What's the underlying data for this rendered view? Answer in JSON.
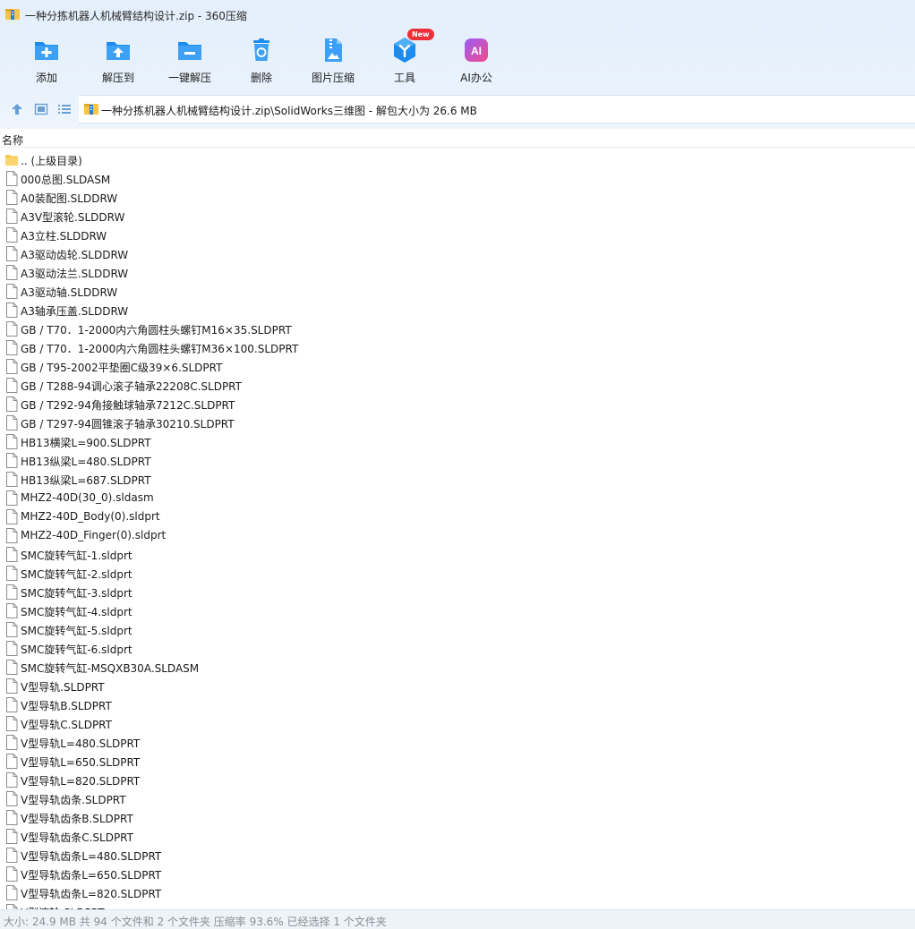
{
  "window": {
    "title": "一种分拣机器人机械臂结构设计.zip - 360压缩"
  },
  "toolbar": {
    "add": "添加",
    "extract_to": "解压到",
    "one_click_extract": "一键解压",
    "delete": "删除",
    "image_compress": "图片压缩",
    "tools": "工具",
    "tools_badge": "New",
    "ai_office": "AI办公",
    "ai_icon_text": "AI"
  },
  "colors": {
    "accent": "#1c8cf0",
    "badge": "#ef2f37",
    "folder": "#f6c54a",
    "ai_gradient_start": "#9b5cf6",
    "ai_gradient_end": "#f24b8a"
  },
  "address": {
    "path": "一种分拣机器人机械臂结构设计.zip\\SolidWorks三维图 - 解包大小为 26.6 MB"
  },
  "list": {
    "column_name": "名称",
    "files": [
      {
        "name": ".. (上级目录)",
        "icon": "folder-icon"
      },
      {
        "name": "000总图.SLDASM",
        "icon": "file-icon"
      },
      {
        "name": "A0装配图.SLDDRW",
        "icon": "file-icon"
      },
      {
        "name": "A3V型滚轮.SLDDRW",
        "icon": "file-icon"
      },
      {
        "name": "A3立柱.SLDDRW",
        "icon": "file-icon"
      },
      {
        "name": "A3驱动齿轮.SLDDRW",
        "icon": "file-icon"
      },
      {
        "name": "A3驱动法兰.SLDDRW",
        "icon": "file-icon"
      },
      {
        "name": "A3驱动轴.SLDDRW",
        "icon": "file-icon"
      },
      {
        "name": "A3轴承压盖.SLDDRW",
        "icon": "file-icon"
      },
      {
        "name": "GB / T70．1-2000内六角圆柱头螺钉M16×35.SLDPRT",
        "icon": "file-icon"
      },
      {
        "name": "GB / T70．1-2000内六角圆柱头螺钉M36×100.SLDPRT",
        "icon": "file-icon"
      },
      {
        "name": "GB / T95-2002平垫圈C级39×6.SLDPRT",
        "icon": "file-icon"
      },
      {
        "name": "GB / T288-94调心滚子轴承22208C.SLDPRT",
        "icon": "file-icon"
      },
      {
        "name": "GB / T292-94角接触球轴承7212C.SLDPRT",
        "icon": "file-icon"
      },
      {
        "name": "GB / T297-94圆锥滚子轴承30210.SLDPRT",
        "icon": "file-icon"
      },
      {
        "name": "HB13横梁L=900.SLDPRT",
        "icon": "file-icon"
      },
      {
        "name": "HB13纵梁L=480.SLDPRT",
        "icon": "file-icon"
      },
      {
        "name": "HB13纵梁L=687.SLDPRT",
        "icon": "file-icon"
      },
      {
        "name": "MHZ2-40D(30_0).sldasm",
        "icon": "file-icon"
      },
      {
        "name": "MHZ2-40D_Body(0).sldprt",
        "icon": "file-icon"
      },
      {
        "name": "MHZ2-40D_Finger(0).sldprt",
        "icon": "file-icon"
      },
      {
        "name": "SMC旋转气缸-1.sldprt",
        "icon": "file-icon"
      },
      {
        "name": "SMC旋转气缸-2.sldprt",
        "icon": "file-icon"
      },
      {
        "name": "SMC旋转气缸-3.sldprt",
        "icon": "file-icon"
      },
      {
        "name": "SMC旋转气缸-4.sldprt",
        "icon": "file-icon"
      },
      {
        "name": "SMC旋转气缸-5.sldprt",
        "icon": "file-icon"
      },
      {
        "name": "SMC旋转气缸-6.sldprt",
        "icon": "file-icon"
      },
      {
        "name": "SMC旋转气缸-MSQXB30A.SLDASM",
        "icon": "file-icon"
      },
      {
        "name": "V型导轨.SLDPRT",
        "icon": "file-icon"
      },
      {
        "name": "V型导轨B.SLDPRT",
        "icon": "file-icon"
      },
      {
        "name": "V型导轨C.SLDPRT",
        "icon": "file-icon"
      },
      {
        "name": "V型导轨L=480.SLDPRT",
        "icon": "file-icon"
      },
      {
        "name": "V型导轨L=650.SLDPRT",
        "icon": "file-icon"
      },
      {
        "name": "V型导轨L=820.SLDPRT",
        "icon": "file-icon"
      },
      {
        "name": "V型导轨齿条.SLDPRT",
        "icon": "file-icon"
      },
      {
        "name": "V型导轨齿条B.SLDPRT",
        "icon": "file-icon"
      },
      {
        "name": "V型导轨齿条C.SLDPRT",
        "icon": "file-icon"
      },
      {
        "name": "V型导轨齿条L=480.SLDPRT",
        "icon": "file-icon"
      },
      {
        "name": "V型导轨齿条L=650.SLDPRT",
        "icon": "file-icon"
      },
      {
        "name": "V型导轨齿条L=820.SLDPRT",
        "icon": "file-icon"
      },
      {
        "name": "V型滚轮.SLDPRT",
        "icon": "file-icon"
      }
    ]
  },
  "status": {
    "text": "大小: 24.9 MB 共 94 个文件和 2 个文件夹 压缩率 93.6% 已经选择 1 个文件夹"
  }
}
